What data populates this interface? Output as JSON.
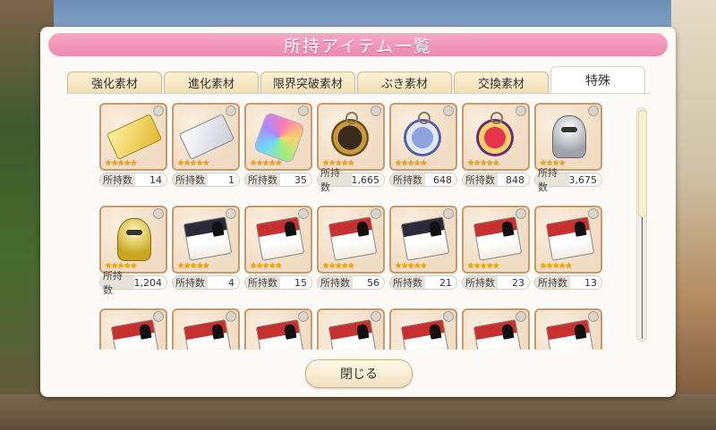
{
  "dialog": {
    "title": "所持アイテム一覧",
    "close_label": "閉じる"
  },
  "tabs": [
    {
      "label": "強化素材",
      "active": false
    },
    {
      "label": "進化素材",
      "active": false
    },
    {
      "label": "限界突破素材",
      "active": false
    },
    {
      "label": "ぶき素材",
      "active": false
    },
    {
      "label": "交換素材",
      "active": false
    },
    {
      "label": "特殊",
      "active": true
    }
  ],
  "count_label": "所持数",
  "items": [
    {
      "art": "ticket-gold",
      "stars": "★★★★★",
      "count": "14"
    },
    {
      "art": "ticket-silver",
      "stars": "★★★★★",
      "count": "1"
    },
    {
      "art": "rainbow-crystal",
      "stars": "★★★★★",
      "count": "35"
    },
    {
      "art": "watch-gold",
      "stars": "★★★★★",
      "count": "1,665"
    },
    {
      "art": "watch-blue",
      "stars": "★★★★★",
      "count": "648"
    },
    {
      "art": "watch-red",
      "stars": "★★★★★",
      "count": "848"
    },
    {
      "art": "bot-silver",
      "stars": "★★★★",
      "count": "3,675"
    },
    {
      "art": "bot-gold",
      "stars": "★★★★★",
      "count": "1,204"
    },
    {
      "art": "ticket-dark",
      "stars": "★★★★★",
      "count": "4"
    },
    {
      "art": "ticket-red",
      "stars": "★★★★★",
      "count": "15"
    },
    {
      "art": "ticket-red",
      "stars": "★★★★★",
      "count": "56"
    },
    {
      "art": "ticket-dark",
      "stars": "★★★★★",
      "count": "21"
    },
    {
      "art": "ticket-red",
      "stars": "★★★★★",
      "count": "23"
    },
    {
      "art": "ticket-red",
      "stars": "★★★★★",
      "count": "13"
    },
    {
      "art": "ticket-red",
      "stars": "",
      "count": ""
    },
    {
      "art": "ticket-red",
      "stars": "",
      "count": ""
    },
    {
      "art": "ticket-red",
      "stars": "",
      "count": ""
    },
    {
      "art": "ticket-red",
      "stars": "",
      "count": ""
    },
    {
      "art": "ticket-red",
      "stars": "",
      "count": ""
    },
    {
      "art": "ticket-red",
      "stars": "",
      "count": ""
    },
    {
      "art": "ticket-red",
      "stars": "",
      "count": ""
    }
  ],
  "scroll_fraction": 0.45,
  "colors": {
    "title_bar": "#ee89b1",
    "tab_bg": "#f3dfb4",
    "star": "#f5a600",
    "frame": "#c99a6c"
  }
}
